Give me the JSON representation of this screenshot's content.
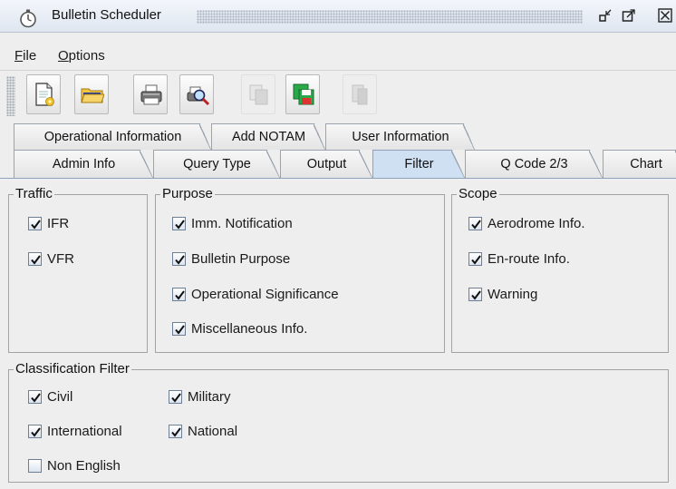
{
  "window": {
    "title": "Bulletin Scheduler",
    "icon": "stopwatch-icon",
    "controls": [
      "iconify-icon",
      "maximize-icon",
      "close-icon"
    ]
  },
  "menu": {
    "file_mnemonic": "F",
    "file_rest": "ile",
    "options_mnemonic": "O",
    "options_rest": "ptions"
  },
  "toolbar": {
    "buttons": [
      {
        "icon": "new-document-icon",
        "enabled": true
      },
      {
        "icon": "open-folder-icon",
        "enabled": true
      },
      {
        "icon": "print-icon",
        "enabled": true
      },
      {
        "icon": "print-preview-icon",
        "enabled": true
      },
      {
        "icon": "copy-icon",
        "enabled": false
      },
      {
        "icon": "save-icon",
        "enabled": true
      },
      {
        "icon": "paste-icon",
        "enabled": false
      }
    ]
  },
  "tabs_row1": [
    "Operational Information",
    "Add NOTAM",
    "User Information"
  ],
  "tabs_row2": [
    "Admin Info",
    "Query Type",
    "Output",
    "Filter",
    "Q Code 2/3",
    "Chart"
  ],
  "selected_tab": "Filter",
  "traffic": {
    "legend": "Traffic",
    "items": [
      {
        "label": "IFR",
        "checked": true
      },
      {
        "label": "VFR",
        "checked": true
      }
    ]
  },
  "purpose": {
    "legend": "Purpose",
    "items": [
      {
        "label": "Imm. Notification",
        "checked": true
      },
      {
        "label": "Bulletin Purpose",
        "checked": true
      },
      {
        "label": "Operational Significance",
        "checked": true
      },
      {
        "label": "Miscellaneous Info.",
        "checked": true
      }
    ]
  },
  "scope": {
    "legend": "Scope",
    "items": [
      {
        "label": "Aerodrome Info.",
        "checked": true
      },
      {
        "label": "En-route Info.",
        "checked": true
      },
      {
        "label": "Warning",
        "checked": true
      }
    ]
  },
  "classification": {
    "legend": "Classification Filter",
    "items": [
      {
        "label": "Civil",
        "checked": true
      },
      {
        "label": "Military",
        "checked": true
      },
      {
        "label": "International",
        "checked": true
      },
      {
        "label": "National",
        "checked": true
      },
      {
        "label": "Non English",
        "checked": false
      }
    ]
  }
}
